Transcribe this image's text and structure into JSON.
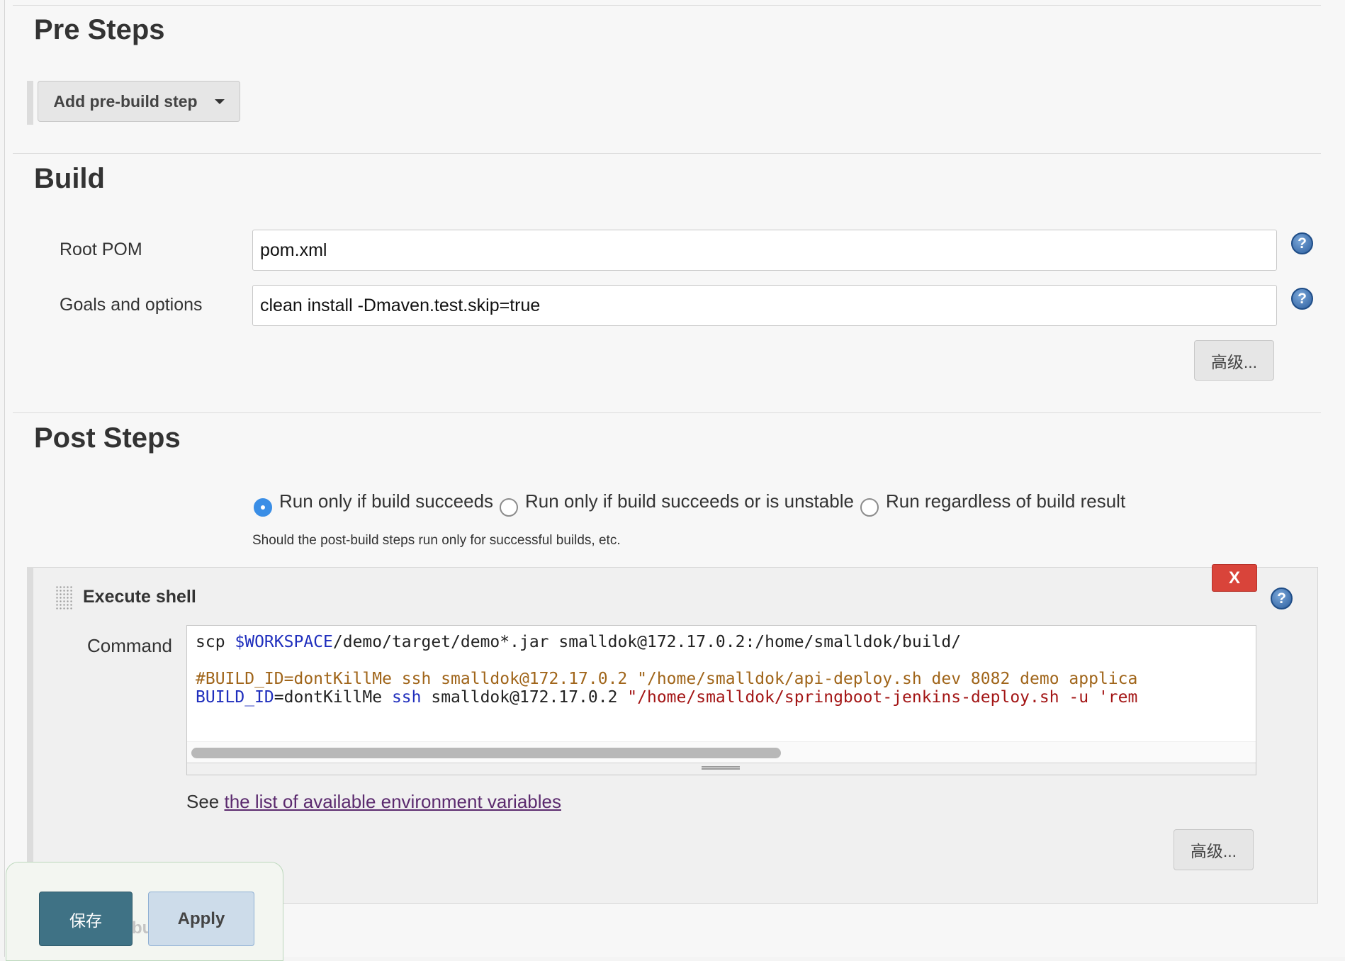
{
  "pre_steps": {
    "title": "Pre Steps",
    "add_button_label": "Add pre-build step"
  },
  "build": {
    "title": "Build",
    "root_pom_label": "Root POM",
    "root_pom_value": "pom.xml",
    "goals_label": "Goals and options",
    "goals_value": "clean install -Dmaven.test.skip=true",
    "advanced_label": "高级..."
  },
  "post_steps": {
    "title": "Post Steps",
    "radio_options": [
      {
        "label": "Run only if build succeeds",
        "checked": true
      },
      {
        "label": "Run only if build succeeds or is unstable",
        "checked": false
      },
      {
        "label": "Run regardless of build result",
        "checked": false
      }
    ],
    "description": "Should the post-build steps run only for successful builds, etc."
  },
  "execute_shell": {
    "title": "Execute shell",
    "close_label": "X",
    "command_label": "Command",
    "code_lines": [
      [
        {
          "t": "scp "
        },
        {
          "t": "$WORKSPACE",
          "c": "c-var"
        },
        {
          "t": "/demo/target/demo*.jar smalldok@172.17.0.2:/home/smalldok/build/"
        }
      ],
      [
        {
          "t": ""
        }
      ],
      [
        {
          "t": "#BUILD_ID=dontKillMe ssh smalldok@172.17.0.2 \"/home/smalldok/api-deploy.sh dev 8082 demo applica",
          "c": "c-cmt"
        }
      ],
      [
        {
          "t": "BUILD_ID",
          "c": "c-var"
        },
        {
          "t": "=dontKillMe "
        },
        {
          "t": "ssh",
          "c": "c-kw"
        },
        {
          "t": " smalldok@172.17.0.2 "
        },
        {
          "t": "\"/home/smalldok/springboot-jenkins-deploy.sh -u 'rem",
          "c": "c-str"
        }
      ]
    ],
    "see_prefix": "See ",
    "env_link_label": "the list of available environment variables",
    "advanced_label": "高级..."
  },
  "bottom_bar": {
    "ghost_text": "bu",
    "save_label": "保存",
    "apply_label": "Apply"
  },
  "icons": {
    "help_icon_glyph": "?"
  }
}
